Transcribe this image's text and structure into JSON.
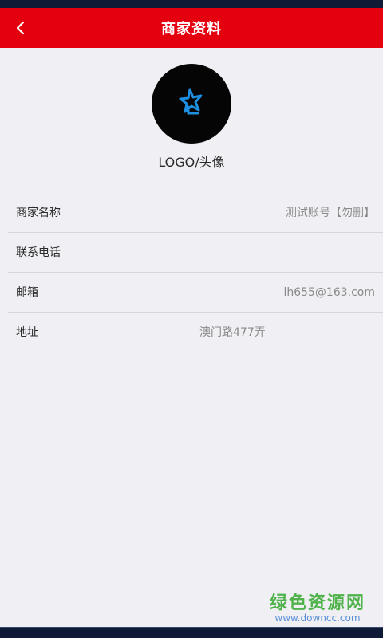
{
  "header": {
    "title": "商家资料",
    "back_icon": "chevron-left-icon",
    "background": "#e5000f"
  },
  "avatar": {
    "caption": "LOGO/头像",
    "icon": "star-logo-icon"
  },
  "fields": [
    {
      "label": "商家名称",
      "value": "测试账号【勿删】"
    },
    {
      "label": "联系电话",
      "value": ""
    },
    {
      "label": "邮箱",
      "value": "lh655@163.com"
    },
    {
      "label": "地址",
      "value": "澳门路477弄"
    }
  ],
  "watermark": {
    "main": "绿色资源网",
    "sub": "www.downcc.com"
  }
}
